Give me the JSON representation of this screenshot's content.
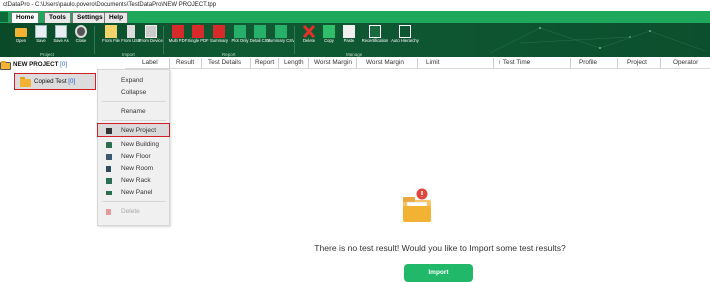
{
  "window": {
    "title": "ctDataPro - C:\\Users\\paulo.povero\\Documents\\TestDataPro\\NEW PROJECT.tpp"
  },
  "menu": {
    "tabs": [
      "Home",
      "Tools",
      "Settings",
      "Help"
    ],
    "active": "Home"
  },
  "ribbon": {
    "buttons": [
      {
        "label": "Open",
        "icon": "open-folder-icon"
      },
      {
        "label": "Save",
        "icon": "save-icon"
      },
      {
        "label": "Save As",
        "icon": "save-as-icon"
      },
      {
        "label": "Close",
        "icon": "close-circle-icon"
      },
      {
        "label": "From File",
        "icon": "file-import-icon"
      },
      {
        "label": "From USB",
        "icon": "usb-import-icon"
      },
      {
        "label": "From Device",
        "icon": "device-import-icon"
      },
      {
        "label": "Multi PDF",
        "icon": "pdf-icon"
      },
      {
        "label": "Single PDF",
        "icon": "pdf-icon"
      },
      {
        "label": "Summary",
        "icon": "pdf-summary-icon"
      },
      {
        "label": "Plot Only",
        "icon": "plot-icon"
      },
      {
        "label": "Detail CSV",
        "icon": "csv-icon"
      },
      {
        "label": "Summary CSV",
        "icon": "csv-summary-icon"
      },
      {
        "label": "Delete",
        "icon": "delete-x-icon"
      },
      {
        "label": "Copy",
        "icon": "copy-icon"
      },
      {
        "label": "Paste",
        "icon": "paste-icon"
      },
      {
        "label": "Recertification",
        "icon": "recertification-icon"
      },
      {
        "label": "Auto Hierarchy",
        "icon": "hierarchy-icon"
      }
    ],
    "groups": [
      "Project",
      "Import",
      "Report",
      "Manage"
    ]
  },
  "tree": {
    "root_label": "NEW PROJECT",
    "root_count": "[0]",
    "child_label": "Copied Test",
    "child_count": "[0]"
  },
  "context_menu": {
    "items": [
      {
        "label": "Expand",
        "icon": ""
      },
      {
        "label": "Collapse",
        "icon": ""
      },
      {
        "label": "Rename",
        "icon": ""
      },
      {
        "label": "New Project",
        "icon": "folder-icon"
      },
      {
        "label": "New Building",
        "icon": "building-icon"
      },
      {
        "label": "New Floor",
        "icon": "floor-icon"
      },
      {
        "label": "New Room",
        "icon": "room-icon"
      },
      {
        "label": "New Rack",
        "icon": "rack-icon"
      },
      {
        "label": "New Panel",
        "icon": "panel-icon"
      },
      {
        "label": "Delete",
        "icon": "trash-icon"
      }
    ],
    "highlighted": "New Project"
  },
  "table": {
    "columns": [
      "Label",
      "Result",
      "Test Details",
      "Report",
      "Length",
      "Worst Margin",
      "Worst Margin",
      "Limit",
      "↑ Test Time",
      "Profile",
      "Project",
      "Operator"
    ]
  },
  "empty_state": {
    "message": "There is no test result! Would you like to Import some test results?",
    "button_label": "Import"
  },
  "colors": {
    "brand_green": "#1fa85b",
    "ribbon_dark": "#0f5a33",
    "highlight_red": "#d11f2a",
    "import_green": "#21b86a"
  }
}
